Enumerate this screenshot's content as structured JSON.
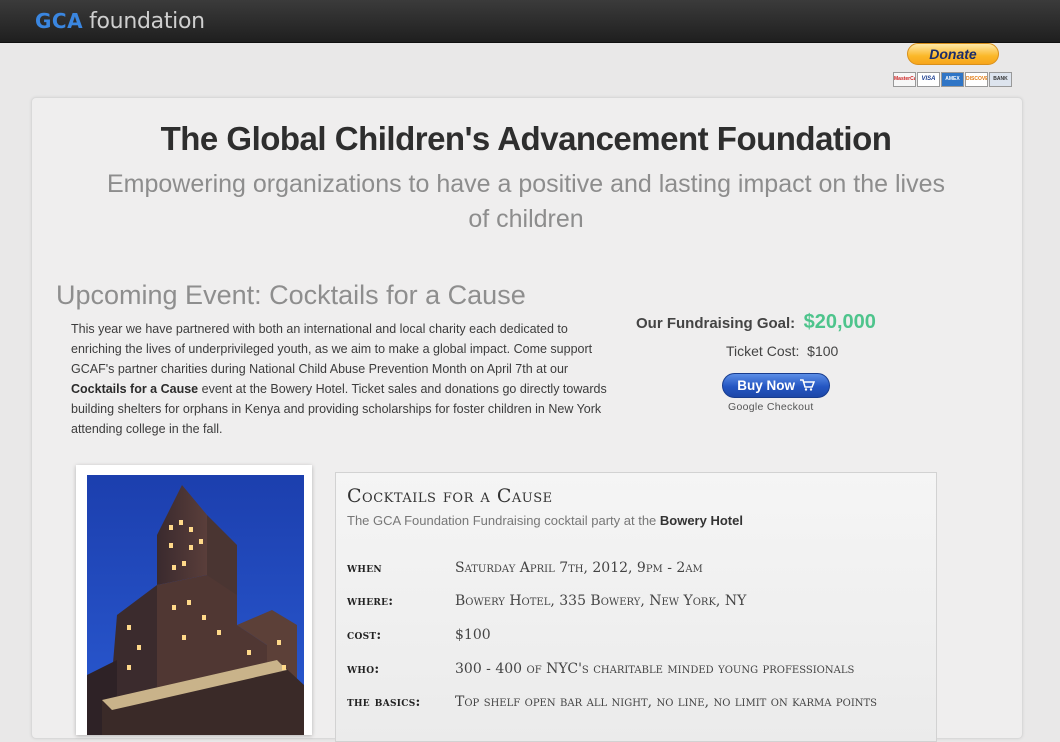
{
  "header": {
    "logo_primary": "GCA",
    "logo_secondary": "foundation"
  },
  "donate": {
    "label": "Donate",
    "cards": [
      "MasterCard",
      "VISA",
      "AMEX",
      "DISCOVER",
      "BANK"
    ]
  },
  "hero": {
    "title": "The Global Children's Advancement Foundation",
    "subtitle": "Empowering organizations to have a positive and lasting impact on the lives of children"
  },
  "event": {
    "heading": "Upcoming Event: Cocktails for a Cause",
    "description_before": "This year we have partnered with both an international and local charity each dedicated to enriching the lives of underprivileged youth, as we aim to make a global impact. Come support GCAF's partner charities during National Child Abuse Prevention Month on April 7th at our ",
    "description_bold": "Cocktails for a Cause",
    "description_after": " event at the Bowery Hotel. Ticket sales and donations go directly towards building shelters for orphans in Kenya and providing scholarships for foster children in New York attending college in the fall."
  },
  "fundraising": {
    "goal_label": "Our Fundraising Goal:",
    "goal_amount": "$20,000",
    "ticket_label": "Ticket Cost:",
    "ticket_price": "$100",
    "buy_label": "Buy Now",
    "checkout_label": "Google Checkout"
  },
  "details": {
    "title": "Cocktails for a Cause",
    "subtitle_before": "The GCA Foundation Fundraising cocktail party at the ",
    "subtitle_bold": "Bowery Hotel",
    "rows": [
      {
        "label": "when",
        "value": "Saturday April 7th, 2012, 9pm - 2am"
      },
      {
        "label": "where:",
        "value": "Bowery Hotel, 335 Bowery, New York, NY"
      },
      {
        "label": "cost:",
        "value": "$100"
      },
      {
        "label": "who:",
        "value": "300 - 400 of NYC's charitable minded young professionals"
      },
      {
        "label": "the basics:",
        "value": "Top shelf open bar all night, no line, no limit on karma points"
      }
    ]
  },
  "colors": {
    "accent_blue": "#3a86e0",
    "goal_green": "#4ec48c",
    "donate_gold": "#fbb829"
  },
  "icons": {
    "cart": "cart-icon"
  }
}
